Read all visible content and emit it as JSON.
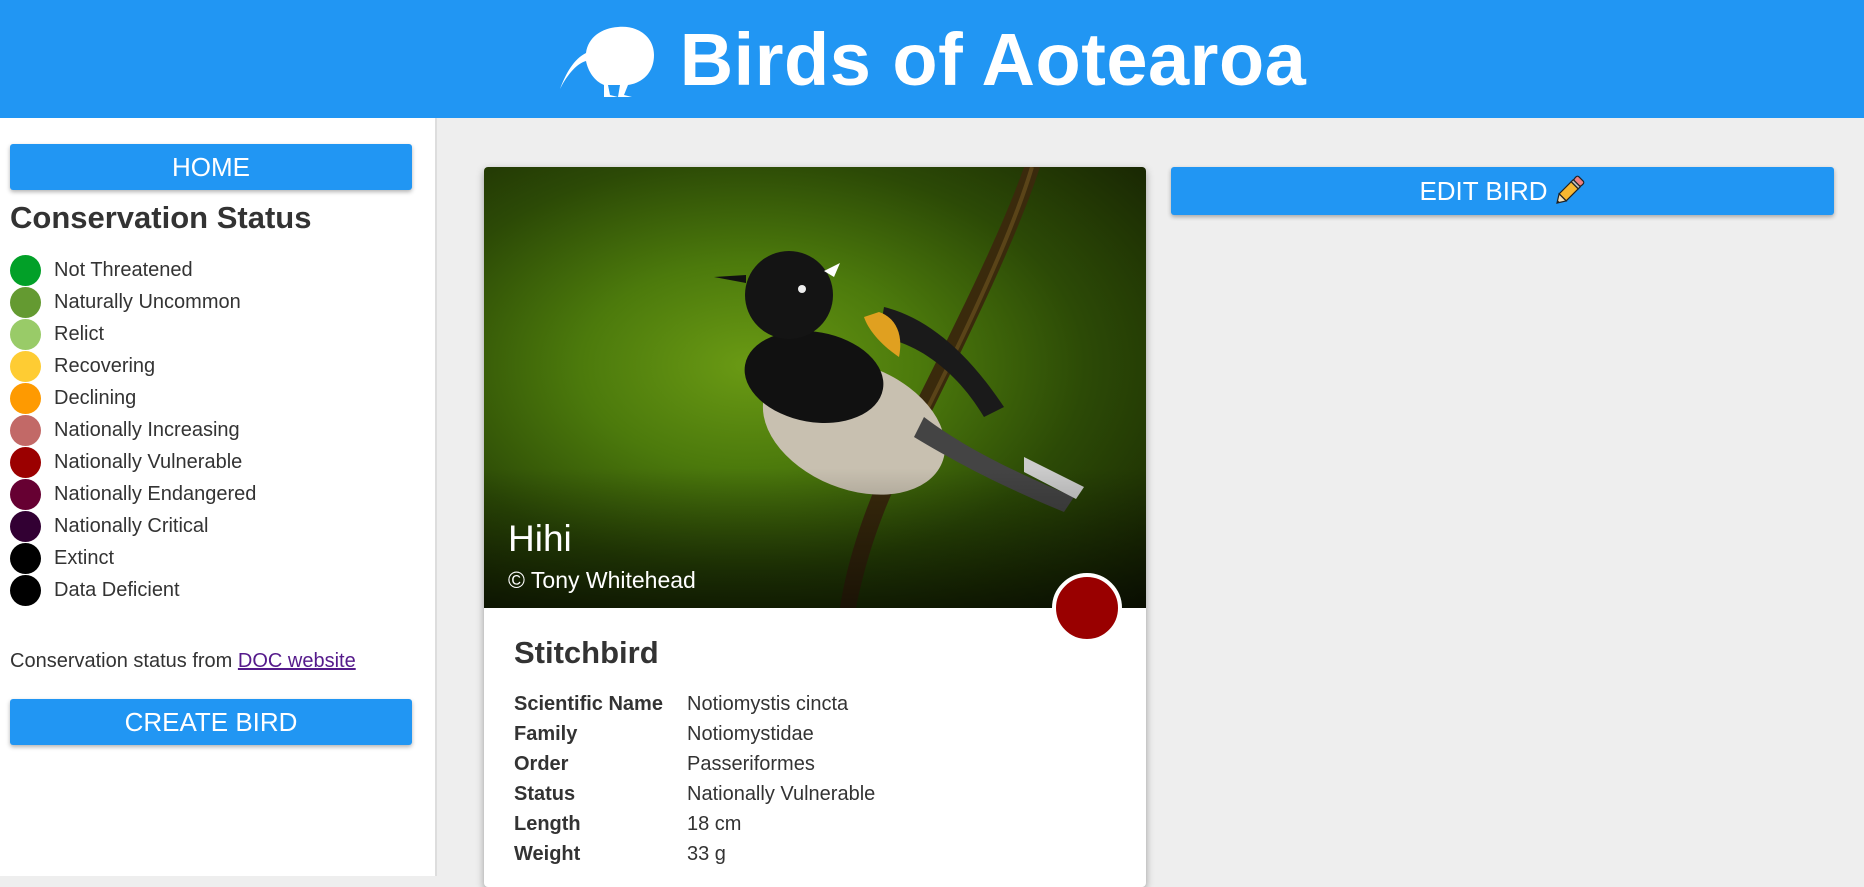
{
  "header": {
    "title": "Birds of Aotearoa",
    "logo_icon": "kiwi-bird-icon"
  },
  "sidebar": {
    "home_label": "HOME",
    "legend_title": "Conservation Status",
    "legend": [
      {
        "label": "Not Threatened",
        "color": "#02a028"
      },
      {
        "label": "Naturally Uncommon",
        "color": "#649a31"
      },
      {
        "label": "Relict",
        "color": "#99cb68"
      },
      {
        "label": "Recovering",
        "color": "#fecc33"
      },
      {
        "label": "Declining",
        "color": "#fe9a01"
      },
      {
        "label": "Nationally Increasing",
        "color": "#c26967"
      },
      {
        "label": "Nationally Vulnerable",
        "color": "#9b0000"
      },
      {
        "label": "Nationally Endangered",
        "color": "#660032"
      },
      {
        "label": "Nationally Critical",
        "color": "#320033"
      },
      {
        "label": "Extinct",
        "color": "#000000"
      },
      {
        "label": "Data Deficient",
        "color": "#000000"
      }
    ],
    "source_text": "Conservation status from",
    "source_link": "DOC website",
    "create_label": "CREATE BIRD"
  },
  "main": {
    "edit_label": "EDIT BIRD",
    "edit_icon": "pencil-icon",
    "card": {
      "primary_name": "Hihi",
      "photo_credit": "© Tony Whitehead",
      "status_color": "#990000",
      "english_name": "Stitchbird",
      "details": [
        {
          "key": "Scientific Name",
          "value": "Notiomystis cincta"
        },
        {
          "key": "Family",
          "value": "Notiomystidae"
        },
        {
          "key": "Order",
          "value": "Passeriformes"
        },
        {
          "key": "Status",
          "value": "Nationally Vulnerable"
        },
        {
          "key": "Length",
          "value": "18 cm"
        },
        {
          "key": "Weight",
          "value": "33 g"
        }
      ]
    }
  }
}
